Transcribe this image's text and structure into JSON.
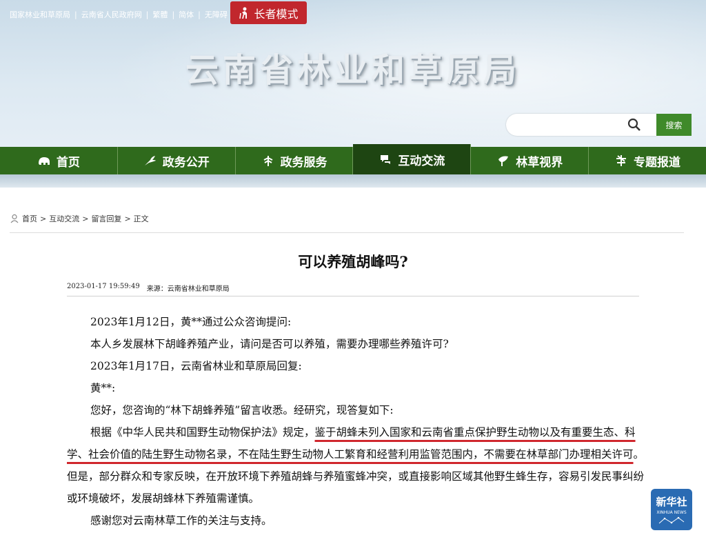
{
  "topbar": {
    "links": [
      "国家林业和草原局",
      "云南省人民政府网",
      "繁體",
      "简体",
      "无障碍"
    ],
    "elder_mode": "长者模式"
  },
  "site_title": "云南省林业和草原局",
  "search": {
    "button": "搜索",
    "placeholder": ""
  },
  "nav": {
    "items": [
      {
        "label": "首页",
        "icon": "elephant-icon"
      },
      {
        "label": "政务公开",
        "icon": "bird-icon"
      },
      {
        "label": "政务服务",
        "icon": "plant-icon"
      },
      {
        "label": "互动交流",
        "icon": "chat-icon",
        "active": true
      },
      {
        "label": "林草视界",
        "icon": "leaf-icon"
      },
      {
        "label": "专题报道",
        "icon": "star-plant-icon"
      }
    ]
  },
  "breadcrumb": {
    "items": [
      "首页",
      "互动交流",
      "留言回复",
      "正文"
    ]
  },
  "article": {
    "title": "可以养殖胡峰吗?",
    "date": "2023-01-17 19:59:49",
    "source": "来源：云南省林业和草原局",
    "p1": "2023年1月12日，黄**通过公众咨询提问:",
    "p2": "本人乡发展林下胡峰养殖产业，请问是否可以养殖，需要办理哪些养殖许可?",
    "p3": "2023年1月17日，云南省林业和草原局回复:",
    "p4": "黄**:",
    "p5": "您好，您咨询的“林下胡蜂养殖”留言收悉。经研究，现答复如下:",
    "p6_a": "根据《中华人民共和国野生动物保护法》规定，",
    "p6_b": "鉴于胡蜂未列入国家和云南省重点保护野生动物以及有重要生态、科学、社会价值的陆生野生动物名录，不在陆生野生动物人工繁育和经营利用监管范围内，不需要在林草部门办理相关许可",
    "p6_c": "。但是，部分群众和专家反映，在开放环境下养殖胡蜂与养殖蜜蜂冲突，或直接影响区域其他野生蜂生存，容易引发民事纠纷或环境破坏，发展胡蜂林下养殖需谨慎。",
    "p7": "感谢您对云南林草工作的关注与支持。"
  },
  "watermark": {
    "cn": "新华社",
    "en": "XINHUA NEWS"
  }
}
